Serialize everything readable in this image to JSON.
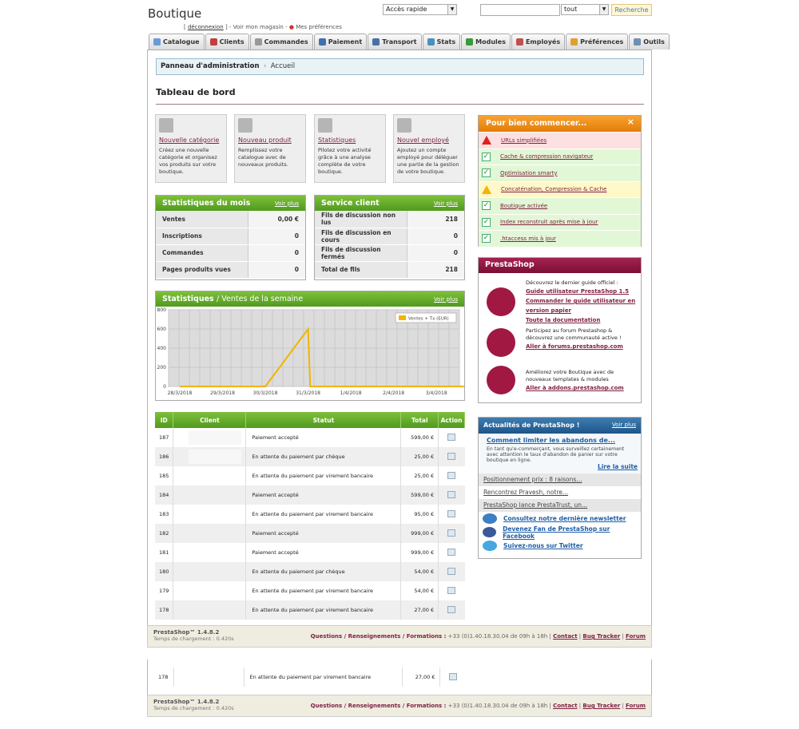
{
  "header": {
    "title": "Boutique",
    "logout": "déconnexion",
    "view_shop": "Voir mon magasin",
    "prefs": "Mes préférences",
    "quick_access": "Accès rapide",
    "search_scope": "tout",
    "search_btn": "Recherche"
  },
  "tabs": [
    "Catalogue",
    "Clients",
    "Commandes",
    "Paiement",
    "Transport",
    "Stats",
    "Modules",
    "Employés",
    "Préférences",
    "Outils"
  ],
  "breadcrumb": {
    "root": "Panneau d'administration",
    "current": "Accueil"
  },
  "page_title": "Tableau de bord",
  "quick_actions": [
    {
      "title": "Nouvelle catégorie",
      "desc": "Créez une nouvelle catégorie et organisez vos produits sur votre boutique."
    },
    {
      "title": "Nouveau produit",
      "desc": "Remplissez votre catalogue avec de nouveaux produits."
    },
    {
      "title": "Statistiques",
      "desc": "Pilotez votre activité grâce à une analyse complète de votre boutique."
    },
    {
      "title": "Nouvel employé",
      "desc": "Ajoutez un compte employé pour déléguer une partie de la gestion de votre boutique."
    }
  ],
  "month_stats": {
    "title": "Statistiques du mois",
    "more": "Voir plus",
    "rows": [
      {
        "k": "Ventes",
        "v": "0,00 €"
      },
      {
        "k": "Inscriptions",
        "v": "0"
      },
      {
        "k": "Commandes",
        "v": "0"
      },
      {
        "k": "Pages produits vues",
        "v": "0"
      }
    ]
  },
  "service": {
    "title": "Service client",
    "more": "Voir plus",
    "rows": [
      {
        "k": "Fils de discussion non lus",
        "v": "218"
      },
      {
        "k": "Fils de discussion en cours",
        "v": "0"
      },
      {
        "k": "Fils de discussion fermés",
        "v": "0"
      },
      {
        "k": "Total de fils",
        "v": "218"
      }
    ]
  },
  "chart_title": "Statistiques",
  "chart_sub": "/ Ventes de la semaine",
  "chart_more": "Voir plus",
  "chart_data": {
    "type": "line",
    "x": [
      "28/3/2018",
      "29/3/2018",
      "30/3/2018",
      "31/3/2018",
      "1/4/2018",
      "2/4/2018",
      "3/4/2018"
    ],
    "series": [
      {
        "name": "Ventes + Tx (EUR)",
        "color": "#f2b400",
        "points": [
          [
            0,
            0
          ],
          [
            2,
            0
          ],
          [
            3,
            599
          ],
          [
            3.05,
            0
          ],
          [
            7,
            0
          ]
        ]
      }
    ],
    "ylim": [
      0,
      800
    ],
    "yticks": [
      0,
      200,
      400,
      600,
      800
    ]
  },
  "orders": {
    "headers": [
      "ID",
      "Client",
      "Statut",
      "Total",
      "Action"
    ],
    "rows": [
      {
        "id": "187",
        "status": "Paiement accepté",
        "total": "599,00 €"
      },
      {
        "id": "186",
        "status": "En attente du paiement par chèque",
        "total": "25,00 €"
      },
      {
        "id": "185",
        "status": "En attente du paiement par virement bancaire",
        "total": "25,00 €"
      },
      {
        "id": "184",
        "status": "Paiement accepté",
        "total": "599,00 €"
      },
      {
        "id": "183",
        "status": "En attente du paiement par virement bancaire",
        "total": "95,00 €"
      },
      {
        "id": "182",
        "status": "Paiement accepté",
        "total": "999,00 €"
      },
      {
        "id": "181",
        "status": "Paiement accepté",
        "total": "999,00 €"
      },
      {
        "id": "180",
        "status": "En attente du paiement par chèque",
        "total": "54,00 €"
      },
      {
        "id": "179",
        "status": "En attente du paiement par virement bancaire",
        "total": "54,00 €"
      },
      {
        "id": "178",
        "status": "En attente du paiement par virement bancaire",
        "total": "27,00 €"
      }
    ]
  },
  "getting_started": {
    "title": "Pour bien commencer...",
    "close": "×",
    "items": [
      {
        "label": "URLs simplifiées",
        "state": "error"
      },
      {
        "label": "Cache & compression navigateur",
        "state": "ok"
      },
      {
        "label": "Optimisation smarty",
        "state": "ok"
      },
      {
        "label": "Concaténation, Compression & Cache",
        "state": "warn"
      },
      {
        "label": "Boutique activée",
        "state": "ok"
      },
      {
        "label": "Index reconstruit après mise à jour",
        "state": "ok"
      },
      {
        "label": ".htaccess mis à jour",
        "state": "ok"
      }
    ]
  },
  "prestashop": {
    "title": "PrestaShop",
    "guide_intro": "Découvrez le dernier guide officiel :",
    "guide_links": [
      "Guide utilisateur PrestaShop 1.5",
      "Commander le guide utilisateur en version papier",
      "Toute la documentation"
    ],
    "forum_text": "Participez au forum Prestashop & découvrez une communauté active !",
    "forum_link": "Aller à forums.prestashop.com",
    "addons_text": "Améliorez votre Boutique avec de nouveaux templates & modules",
    "addons_link": "Aller à addons.prestashop.com"
  },
  "news": {
    "title": "Actualités de PrestaShop !",
    "more": "Voir plus",
    "headline": "Comment limiter les abandons de...",
    "body": "En tant qu'e-commerçant, vous surveillez certainement avec attention le taux d'abandon de panier sur votre boutique en ligne.",
    "read_more": "Lire la suite",
    "items": [
      "Positionnement prix : 8 raisons...",
      "Rencontrez Pravesh, notre...",
      "PrestaShop lance PrestaTrust, un..."
    ],
    "social": [
      "Consultez notre dernière newsletter",
      "Devenez Fan de PrestaShop sur Facebook",
      "Suivez-nous sur Twitter"
    ]
  },
  "footer": {
    "version": "PrestaShop™ 1.4.8.2",
    "load": "Temps de chargement : 0.420s",
    "contact_label": "Questions / Renseignements / Formations :",
    "phone": "+33 (0)1.40.18.30.04",
    "hours": "de 09h à 18h",
    "links": [
      "Contact",
      "Bug Tracker",
      "Forum"
    ]
  },
  "dup": {
    "id": "178",
    "status": "En attente du paiement par virement bancaire",
    "total": "27,00 €"
  }
}
